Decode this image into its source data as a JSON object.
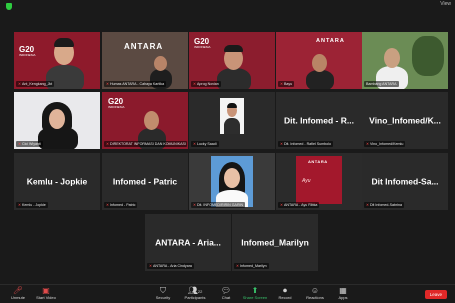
{
  "meeting": {
    "view_label": "View"
  },
  "tiles": {
    "t1": {
      "name": "Ant_Kengkang_Jkt"
    },
    "t2": {
      "name": "Humas ANTARA - Cahaya Kartika"
    },
    "t3": {
      "name": "Aprog Novian"
    },
    "t4": {
      "name": "Bayu"
    },
    "t5": {
      "name": "Bambang ANTARA"
    },
    "t6": {
      "name": "Cici Wiyanti"
    },
    "t7": {
      "name": "DIREKTORAT INFORMASI DAN KOMUNIKASI"
    },
    "t8": {
      "name": "Lucky Saadi"
    },
    "t9": {
      "big": "Dit. Infomed - R...",
      "name": "Dit. Infomed - Rafiel Sumbolo"
    },
    "t10": {
      "big": "Vino_Infomed/K...",
      "name": "Vino_Infomed/Kemlu"
    },
    "t11": {
      "big": "Kemlu - Jopkie",
      "name": "Kemlu - Jopkie"
    },
    "t12": {
      "big": "Infomed - Patric",
      "name": "Infomed - Patric"
    },
    "t13": {
      "name": "Dit. INFOMED/RIRIN GARIN"
    },
    "t14": {
      "name": "ANTARA - Ayu Ribka"
    },
    "t15": {
      "big": "Dit Infomed-Sa...",
      "name": "Dit Infomed-Sabrina"
    },
    "t16": {
      "big": "ANTARA - Aria...",
      "name": "ANTARA - Aria Cindyara"
    },
    "t17": {
      "big": "Infomed_Marilyn",
      "name": "Infomed_Marilyn"
    }
  },
  "toolbar": {
    "unmute": "Unmute",
    "start_video": "Start Video",
    "security": "Security",
    "participants": "Participants",
    "participants_count": "22",
    "chat": "Chat",
    "share_screen": "Share Screen",
    "record": "Record",
    "reactions": "Reactions",
    "apps": "Apps",
    "leave": "Leave"
  },
  "colors": {
    "g20_red": "#8e1a2b",
    "active_speaker": "#f0d64a",
    "share_green": "#39c26b",
    "leave_red": "#e02828"
  }
}
